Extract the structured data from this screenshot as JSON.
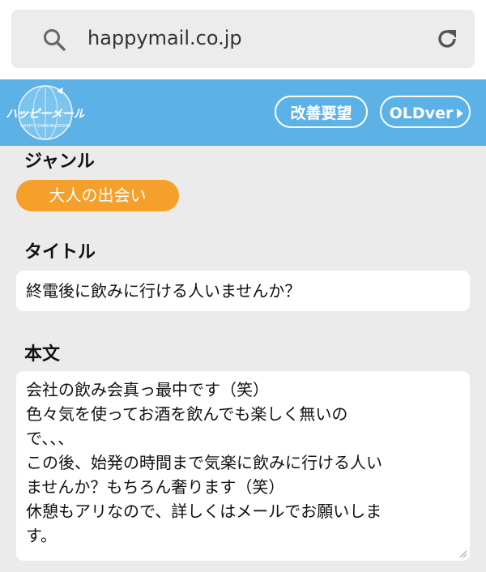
{
  "browser": {
    "url": "happymail.co.jp",
    "icons": {
      "search": "search-icon",
      "reload": "reload-icon"
    }
  },
  "header": {
    "logo_text": "ハッピーメール",
    "logo_subtext": "HAPPY COMMUNICATION",
    "request_button": "改善要望",
    "old_version_button": "OLDver",
    "colors": {
      "header_bg": "#5cb2e6",
      "button_border": "#ffffff"
    }
  },
  "form": {
    "genre_label": "ジャンル",
    "genre_value": "大人の出会い",
    "genre_color": "#f4a02a",
    "title_label": "タイトル",
    "title_value": "終電後に飲みに行ける人いませんか？",
    "body_label": "本文",
    "body_lines": [
      "会社の飲み会真っ最中です（笑）",
      "色々気を使ってお酒を飲んでも楽しく無いの",
      "で、、、",
      "この後、始発の時間まで気楽に飲みに行ける人い",
      "ませんか？もちろん奢ります（笑）",
      "休憩もアリなので、詳しくはメールでお願いしま",
      "す。"
    ]
  }
}
